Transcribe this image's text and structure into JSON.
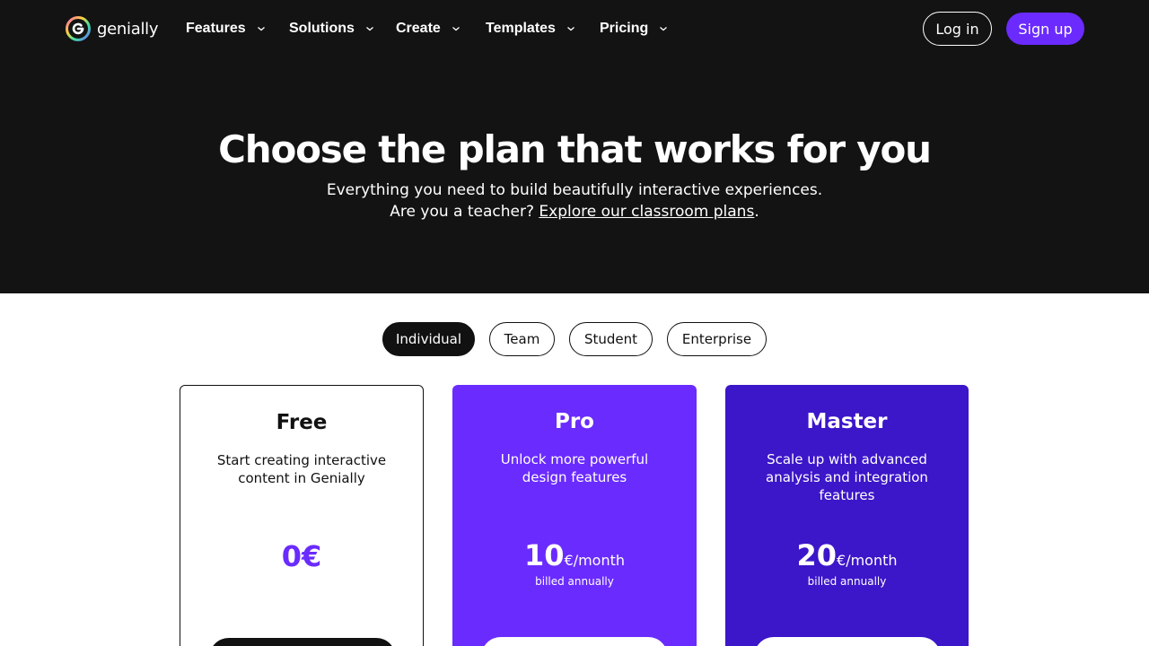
{
  "brand": {
    "name": "genially"
  },
  "nav": {
    "items": [
      {
        "label": "Features"
      },
      {
        "label": "Solutions"
      },
      {
        "label": "Create"
      },
      {
        "label": "Templates"
      },
      {
        "label": "Pricing"
      }
    ],
    "login_label": "Log in",
    "signup_label": "Sign up"
  },
  "hero": {
    "title": "Choose the plan that works for you",
    "subtitle_line1": "Everything you need to build beautifully interactive experiences.",
    "teacher_prompt": "Are you a teacher? ",
    "classroom_link": "Explore our classroom plans",
    "period": "."
  },
  "tabs": [
    {
      "label": "Individual",
      "active": true
    },
    {
      "label": "Team"
    },
    {
      "label": "Student"
    },
    {
      "label": "Enterprise"
    }
  ],
  "plans": [
    {
      "name": "Free",
      "description": "Start creating interactive content in Genially",
      "price": "0€",
      "unit": "",
      "billing": "",
      "color": "#ffffff"
    },
    {
      "name": "Pro",
      "description": "Unlock more powerful design features",
      "price": "10",
      "unit": "€/month",
      "billing": "billed annually",
      "color": "#6a2bff"
    },
    {
      "name": "Master",
      "description": "Scale up with advanced analysis and integration features",
      "price": "20",
      "unit": "€/month",
      "billing": "billed annually",
      "color": "#3c16c9"
    }
  ],
  "colors": {
    "header_bg": "#131313",
    "accent": "#6b2bff",
    "master": "#3c16c9"
  }
}
